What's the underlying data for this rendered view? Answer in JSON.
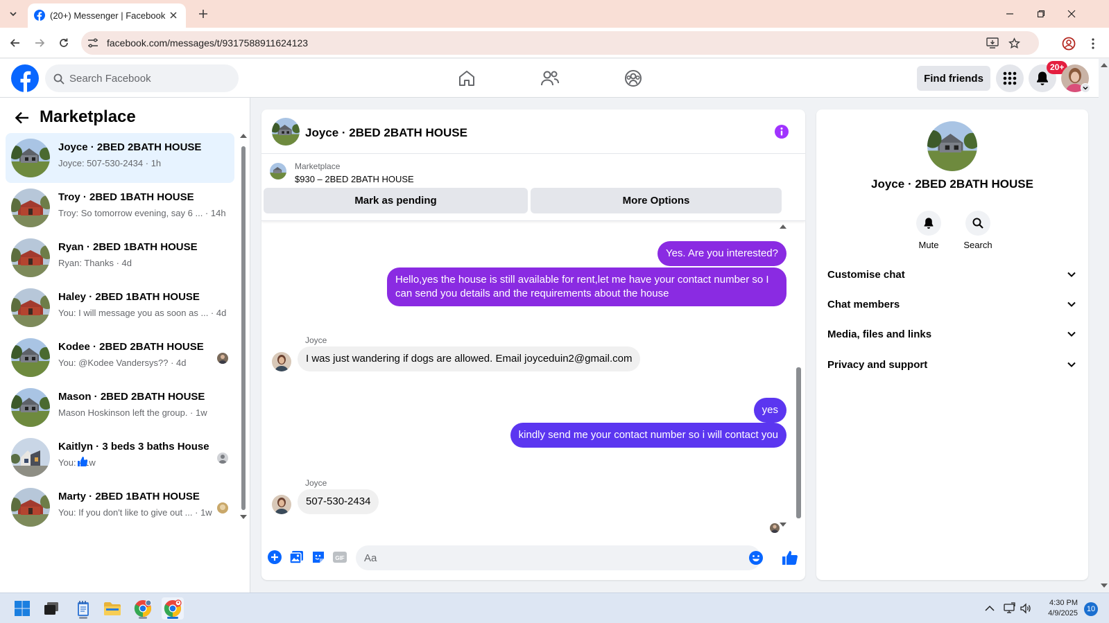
{
  "browser": {
    "tab_title": "(20+) Messenger | Facebook",
    "url": "facebook.com/messages/t/9317588911624123",
    "icons": [
      "tab-search-icon",
      "close-icon",
      "plus-icon",
      "minimize-icon",
      "maximize-icon",
      "close-window-icon",
      "back-icon",
      "forward-icon",
      "reload-icon",
      "site-info-icon",
      "install-icon",
      "star-icon",
      "profile-icon",
      "kebab-menu-icon"
    ]
  },
  "fb_header": {
    "search_placeholder": "Search Facebook",
    "find_friends_label": "Find friends",
    "notifications_badge": "20+",
    "colors": {
      "brand": "#0866ff"
    }
  },
  "left_panel": {
    "title": "Marketplace",
    "conversations": [
      {
        "name": "Joyce · 2BED 2BATH HOUSE",
        "preview": "Joyce: 507-530-2434 · 1h",
        "active": true
      },
      {
        "name": "Troy · 2BED 1BATH HOUSE",
        "preview": "Troy: So tomorrow evening, say 6 ... · 14h"
      },
      {
        "name": "Ryan · 2BED 1BATH HOUSE",
        "preview": "Ryan: Thanks · 4d"
      },
      {
        "name": "Haley · 2BED 1BATH HOUSE",
        "preview": "You: I will message you as soon as ... · 4d"
      },
      {
        "name": "Kodee · 2BED 2BATH HOUSE",
        "preview": "You: @Kodee Vandersys?? · 4d"
      },
      {
        "name": "Mason · 2BED 2BATH HOUSE",
        "preview": "Mason Hoskinson left the group. · 1w"
      },
      {
        "name": "Kaitlyn · 3 beds 3 baths House",
        "preview": "You: · 1w"
      },
      {
        "name": "Marty · 2BED 1BATH HOUSE",
        "preview": "You: If you don't like to give out ... · 1w"
      }
    ]
  },
  "chat": {
    "title": "Joyce · 2BED 2BATH HOUSE",
    "marketplace_label": "Marketplace",
    "listing": "$930 – 2BED 2BATH HOUSE",
    "mark_pending_label": "Mark as pending",
    "more_options_label": "More Options",
    "messages": {
      "m1": "Yes. Are you interested?",
      "m2": "Hello,yes the house is still available for rent,let me have your contact number   so I can send you details and the requirements about the house",
      "sender1": "Joyce",
      "m3": "I was just wandering if dogs are allowed. Email joyceduin2@gmail.com",
      "m4": "yes",
      "m5": "kindly send me your contact number so i will contact you",
      "sender2": "Joyce",
      "m6": "507-530-2434"
    },
    "composer_placeholder": "Aa",
    "colors": {
      "outgoing": "#8a2be2",
      "outgoing_latest": "#5b36f0",
      "accent": "#a033ff"
    }
  },
  "info_panel": {
    "name": "Joyce · 2BED 2BATH HOUSE",
    "mute_label": "Mute",
    "search_label": "Search",
    "sections": [
      "Customise chat",
      "Chat members",
      "Media, files and links",
      "Privacy and support"
    ]
  },
  "taskbar": {
    "time": "4:30 PM",
    "date": "4/9/2025",
    "notification_count": "10"
  }
}
